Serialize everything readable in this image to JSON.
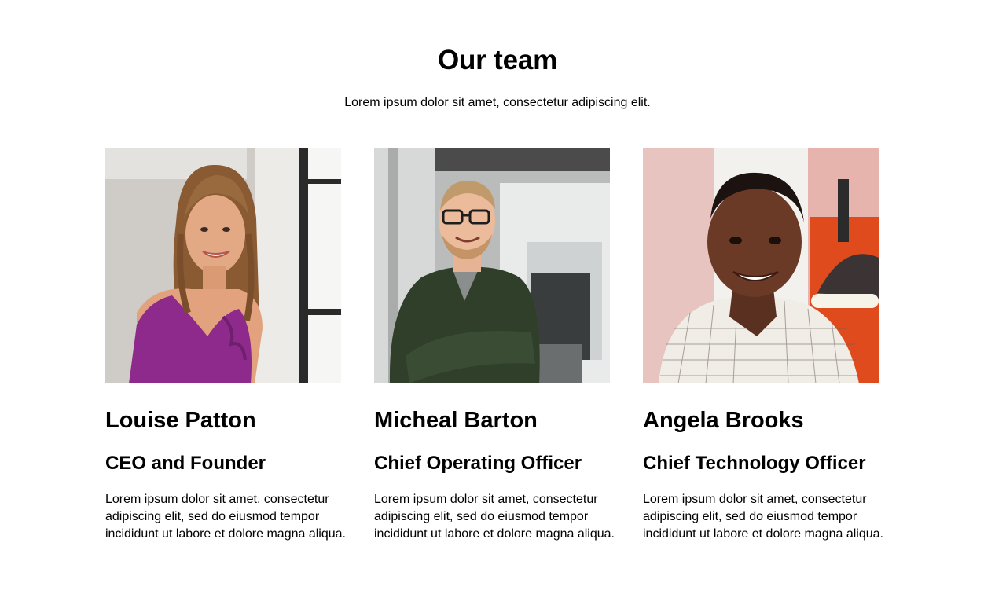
{
  "section": {
    "title": "Our team",
    "subtitle": "Lorem ipsum dolor sit amet, consectetur adipiscing elit."
  },
  "members": [
    {
      "name": "Louise Patton",
      "role": "CEO and Founder",
      "bio": "Lorem ipsum dolor sit amet, consectetur adipiscing elit, sed do eiusmod tempor incididunt ut labore et dolore magna aliqua."
    },
    {
      "name": "Micheal Barton",
      "role": "Chief Operating Officer",
      "bio": "Lorem ipsum dolor sit amet, consectetur adipiscing elit, sed do eiusmod tempor incididunt ut labore et dolore magna aliqua."
    },
    {
      "name": "Angela Brooks",
      "role": "Chief Technology Officer",
      "bio": "Lorem ipsum dolor sit amet, consectetur adipiscing elit, sed do eiusmod tempor incididunt ut labore et dolore magna aliqua."
    }
  ]
}
